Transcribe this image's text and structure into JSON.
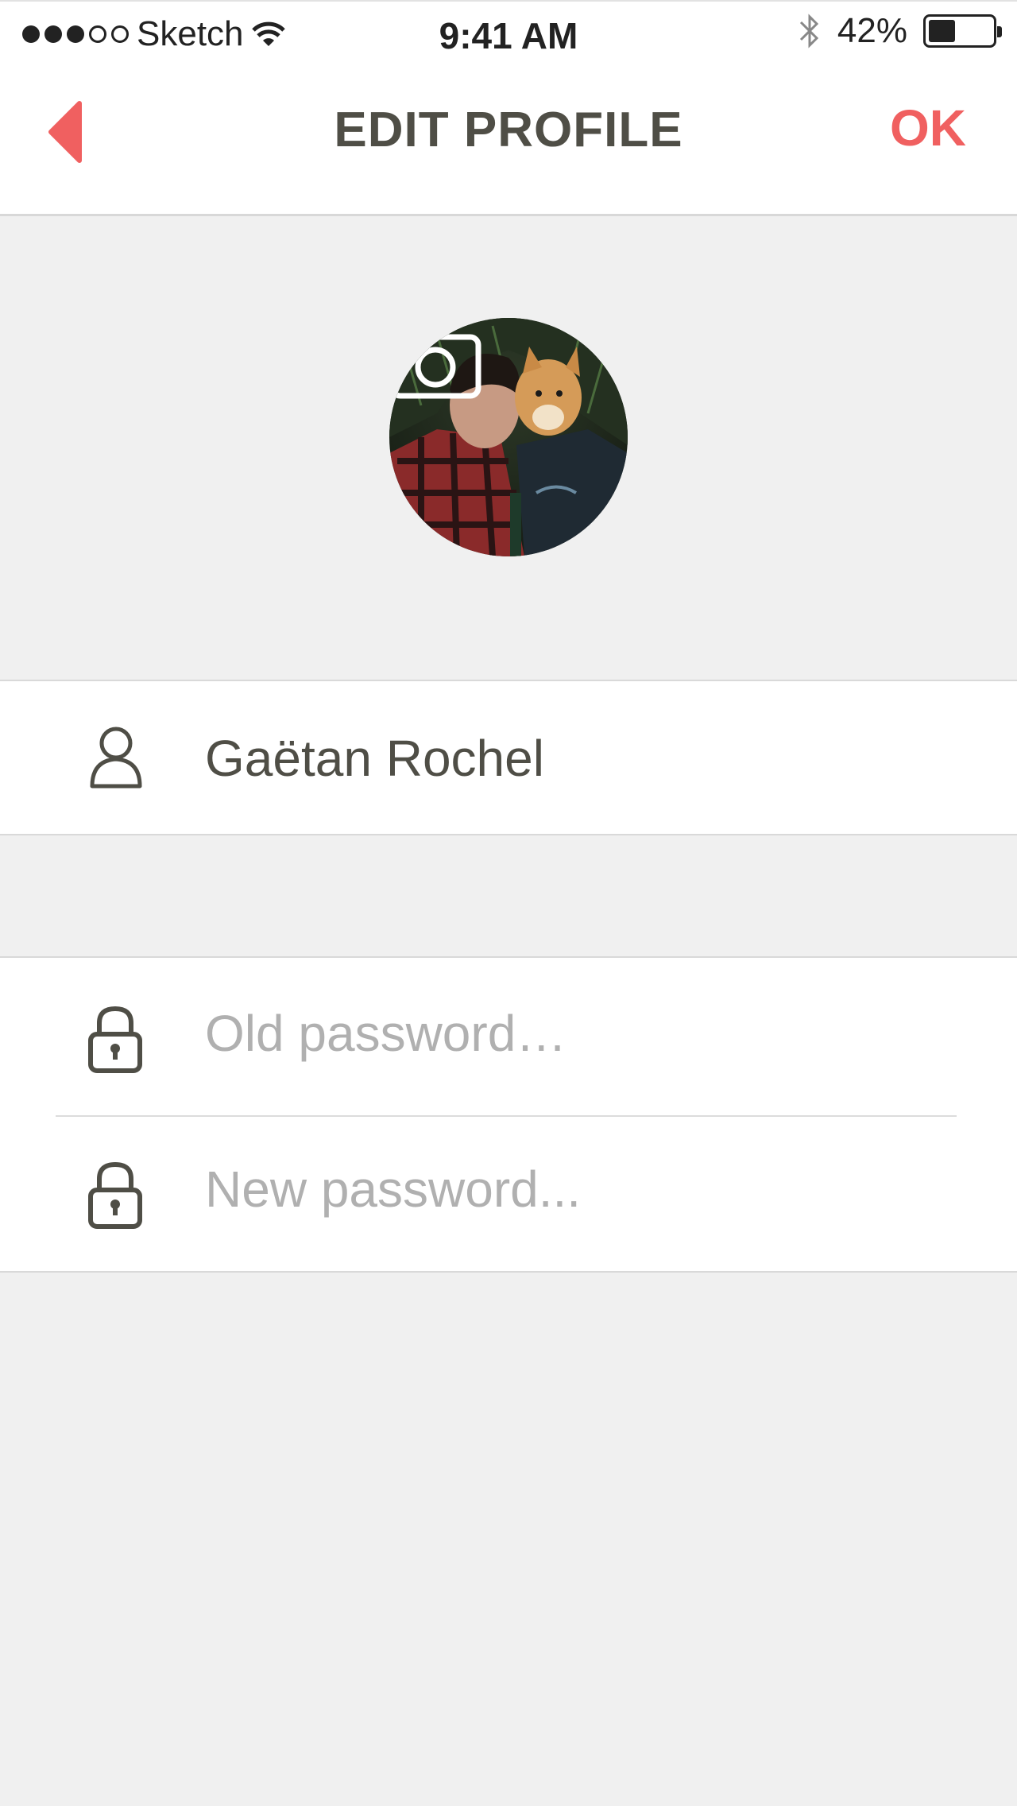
{
  "status_bar": {
    "carrier": "Sketch",
    "time": "9:41 AM",
    "battery_percent": "42%",
    "battery_level": 0.42,
    "signal_bars_filled": 3,
    "signal_bars_total": 5,
    "icons": [
      "wifi-icon",
      "bluetooth-icon",
      "battery-icon"
    ]
  },
  "nav": {
    "title": "EDIT PROFILE",
    "back_icon": "back-chevron-icon",
    "ok_label": "OK"
  },
  "avatar": {
    "overlay_icon": "camera-icon"
  },
  "profile": {
    "name": "Gaëtan Rochel",
    "name_icon": "user-icon"
  },
  "password": {
    "old_placeholder": "Old password…",
    "new_placeholder": "New password...",
    "field_icon": "lock-icon"
  },
  "colors": {
    "accent": "#f06060",
    "text": "#4f4e46",
    "placeholder": "#b0b0b0",
    "background": "#f0f0f0"
  }
}
